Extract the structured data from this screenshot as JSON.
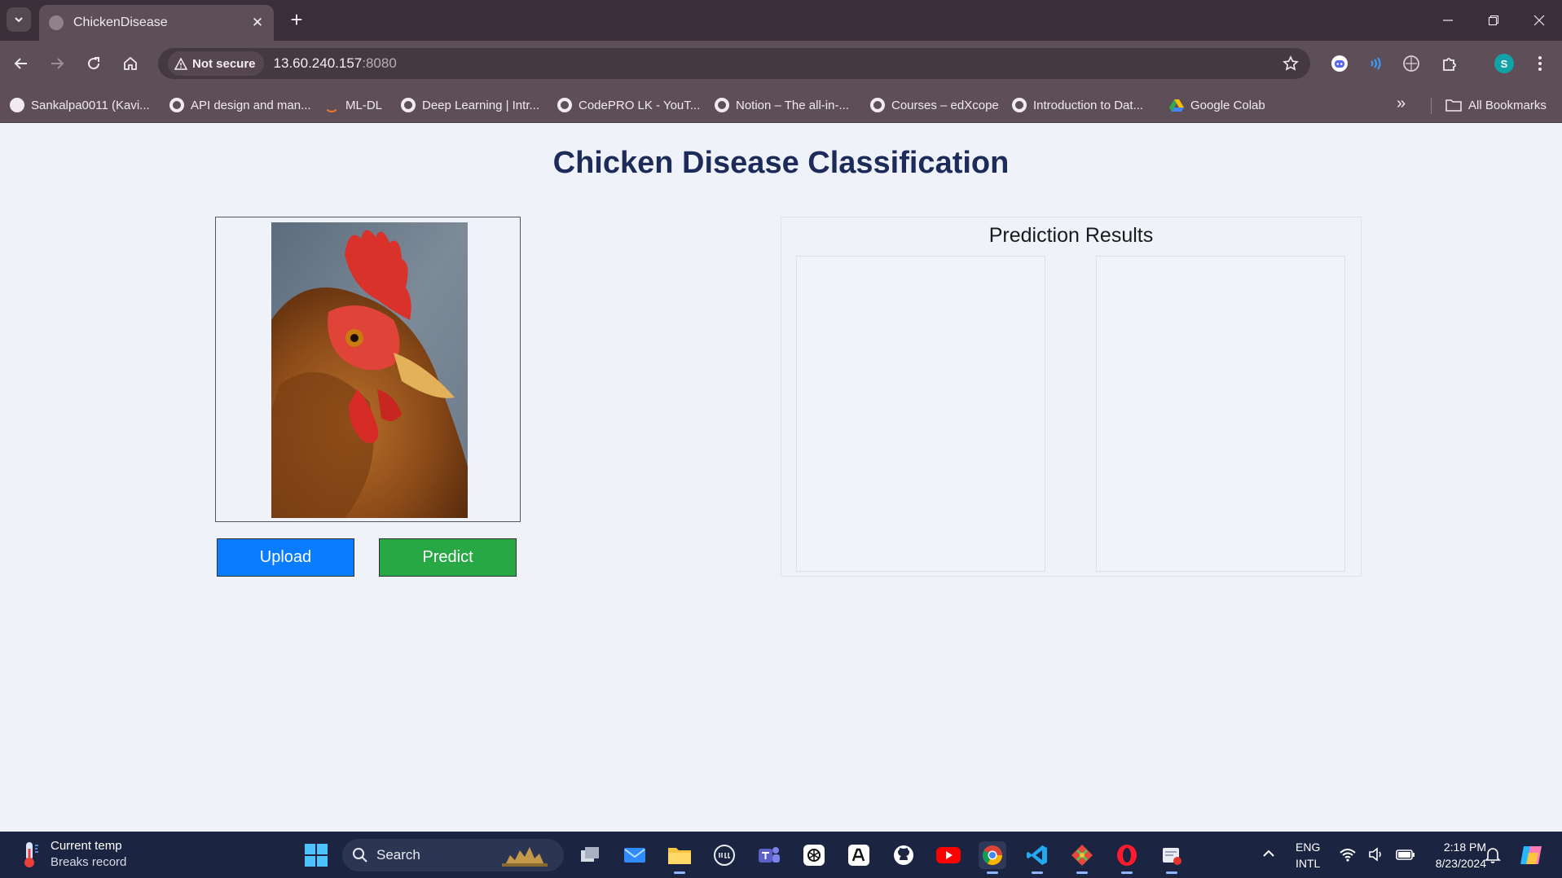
{
  "browser": {
    "tab_title": "ChickenDisease",
    "new_tab": "+",
    "security_label": "Not secure",
    "url_host": "13.60.240.157",
    "url_port": ":8080",
    "profile_initial": "S",
    "bookmarks": [
      {
        "label": "Sankalpa0011 (Kavi...",
        "icon": "github-icon"
      },
      {
        "label": "API design and man...",
        "icon": "globe-icon"
      },
      {
        "label": "ML-DL",
        "icon": "jupyter-icon"
      },
      {
        "label": "Deep Learning | Intr...",
        "icon": "globe-icon"
      },
      {
        "label": "CodePRO LK - YouT...",
        "icon": "globe-icon"
      },
      {
        "label": "Notion – The all-in-...",
        "icon": "globe-icon"
      },
      {
        "label": "Courses – edXcope",
        "icon": "globe-icon"
      },
      {
        "label": "Introduction to Dat...",
        "icon": "globe-icon"
      },
      {
        "label": "Google Colab",
        "icon": "google-drive-icon"
      }
    ],
    "more_bookmarks": "»",
    "all_bookmarks": "All Bookmarks"
  },
  "page": {
    "title": "Chicken Disease Classification",
    "upload_label": "Upload",
    "predict_label": "Predict",
    "results_title": "Prediction Results"
  },
  "taskbar": {
    "weather_title": "Current temp",
    "weather_sub": "Breaks record",
    "search_placeholder": "Search",
    "lang_1": "ENG",
    "lang_2": "INTL",
    "time": "2:18 PM",
    "date": "8/23/2024"
  },
  "colors": {
    "page_background": "#eff2f9",
    "title": "#1c2b5a",
    "upload_button": "#0a7cff",
    "predict_button": "#28a745",
    "browser_frame": "#5e4e58",
    "taskbar": "#1b2440"
  }
}
